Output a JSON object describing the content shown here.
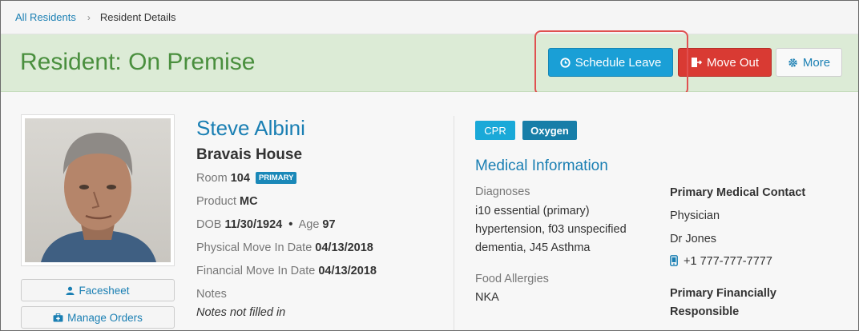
{
  "breadcrumb": {
    "root": "All Residents",
    "separator": "›",
    "current": "Resident Details"
  },
  "header": {
    "title": "Resident: On Premise",
    "buttons": {
      "schedule_leave": "Schedule Leave",
      "move_out": "Move Out",
      "more": "More"
    }
  },
  "sidebar": {
    "facesheet": "Facesheet",
    "manage_orders": "Manage Orders"
  },
  "resident": {
    "name": "Steve Albini",
    "house": "Bravais House",
    "room_label": "Room",
    "room_value": "104",
    "room_badge": "PRIMARY",
    "product_label": "Product",
    "product_value": "MC",
    "dob_label": "DOB",
    "dob_value": "11/30/1924",
    "bullet": "•",
    "age_label": "Age",
    "age_value": "97",
    "physical_move_label": "Physical Move In Date",
    "physical_move_value": "04/13/2018",
    "financial_move_label": "Financial Move In Date",
    "financial_move_value": "04/13/2018",
    "notes_label": "Notes",
    "notes_value": "Notes not filled in"
  },
  "tags": [
    "CPR",
    "Oxygen"
  ],
  "medical": {
    "title": "Medical Information",
    "diagnoses_label": "Diagnoses",
    "diagnoses_lines": [
      "i10 essential (primary)",
      "hypertension, f03 unspecified",
      "dementia, J45 Asthma"
    ],
    "food_allergies_label": "Food Allergies",
    "food_allergies_value": "NKA",
    "primary_contact_label": "Primary Medical Contact",
    "contact_role": "Physician",
    "contact_name": "Dr Jones",
    "contact_phone": "+1 777-777-7777",
    "financial_label_lines": [
      "Primary Financially",
      "Responsible"
    ]
  },
  "colors": {
    "accent_blue": "#1a7fb3",
    "title_green": "#4a8f3e",
    "header_bg": "#dcebd6",
    "schedule_button": "#1a9fd6",
    "move_out_button": "#d93a33",
    "highlight_box": "#e05050"
  },
  "icons": {
    "schedule_leave": "clock-icon",
    "move_out": "exit-door-icon",
    "more": "gear-icon",
    "facesheet": "user-icon",
    "manage_orders": "medkit-icon",
    "phone": "mobile-phone-icon"
  }
}
